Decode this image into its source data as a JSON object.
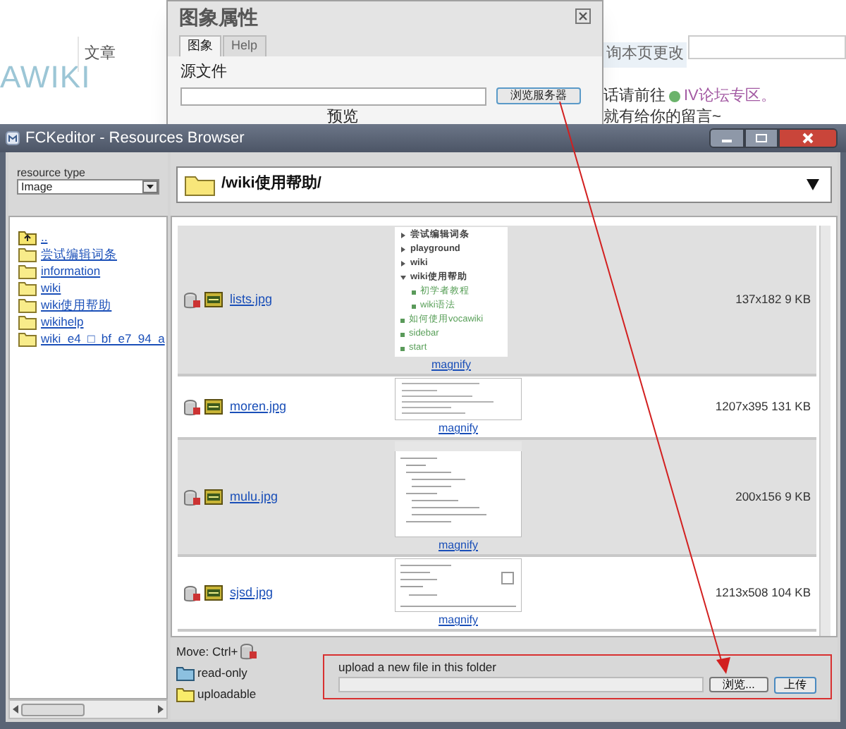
{
  "background_page": {
    "logo": "AWIKI",
    "tab": "文章",
    "watch_link": "询本页更改",
    "forum_prompt": "话请前往",
    "forum_link": "IV论坛专区。",
    "message_line": "就有给你的留言~"
  },
  "image_dialog": {
    "title": "图象属性",
    "tabs": [
      {
        "label": "图象",
        "selected": true
      },
      {
        "label": "Help",
        "selected": false
      }
    ],
    "source_label": "源文件",
    "browse_button": "浏览服务器",
    "preview_label": "预览"
  },
  "browser_window": {
    "title": "FCKeditor - Resources Browser",
    "resource_type_label": "resource type",
    "resource_type": "Image",
    "folders": [
      {
        "name": "..",
        "kind": "up"
      },
      {
        "name": "尝试编辑词条",
        "kind": "folder"
      },
      {
        "name": "information",
        "kind": "folder"
      },
      {
        "name": "wiki",
        "kind": "folder"
      },
      {
        "name": "wiki使用帮助",
        "kind": "folder"
      },
      {
        "name": "wikihelp",
        "kind": "folder"
      },
      {
        "name": "wiki_e4_□_bf_e7_94_a",
        "kind": "folder"
      }
    ],
    "current_folder": "/wiki使用帮助/",
    "files": [
      {
        "name": "lists.jpg",
        "info": "137x182 9 KB",
        "magnify": "magnify",
        "thumbnail": {
          "kind": "list",
          "items": [
            {
              "label": "尝试编辑词条",
              "kind": "namespace",
              "expanded": false
            },
            {
              "label": "playground",
              "kind": "namespace",
              "expanded": false
            },
            {
              "label": "wiki",
              "kind": "namespace",
              "expanded": false
            },
            {
              "label": "wiki使用帮助",
              "kind": "namespace",
              "expanded": true,
              "children": [
                {
                  "label": "初学者教程"
                },
                {
                  "label": "wiki语法"
                }
              ]
            },
            {
              "label": "如何使用vocawiki",
              "kind": "page"
            },
            {
              "label": "sidebar",
              "kind": "page"
            },
            {
              "label": "start",
              "kind": "page"
            }
          ]
        }
      },
      {
        "name": "moren.jpg",
        "info": "1207x395 131 KB",
        "magnify": "magnify",
        "thumbnail": {
          "kind": "wide"
        }
      },
      {
        "name": "mulu.jpg",
        "info": "200x156 9 KB",
        "magnify": "magnify",
        "thumbnail": {
          "kind": "panel"
        }
      },
      {
        "name": "sjsd.jpg",
        "info": "1213x508 104 KB",
        "magnify": "magnify",
        "thumbnail": {
          "kind": "dialog"
        }
      }
    ],
    "move_hint": "Move: Ctrl+",
    "legend": [
      {
        "label": "read-only",
        "kind": "read-only"
      },
      {
        "label": "uploadable",
        "kind": "uploadable"
      }
    ],
    "upload": {
      "label": "upload a new file in this folder",
      "browse_button": "浏览...",
      "upload_button": "上传"
    }
  }
}
